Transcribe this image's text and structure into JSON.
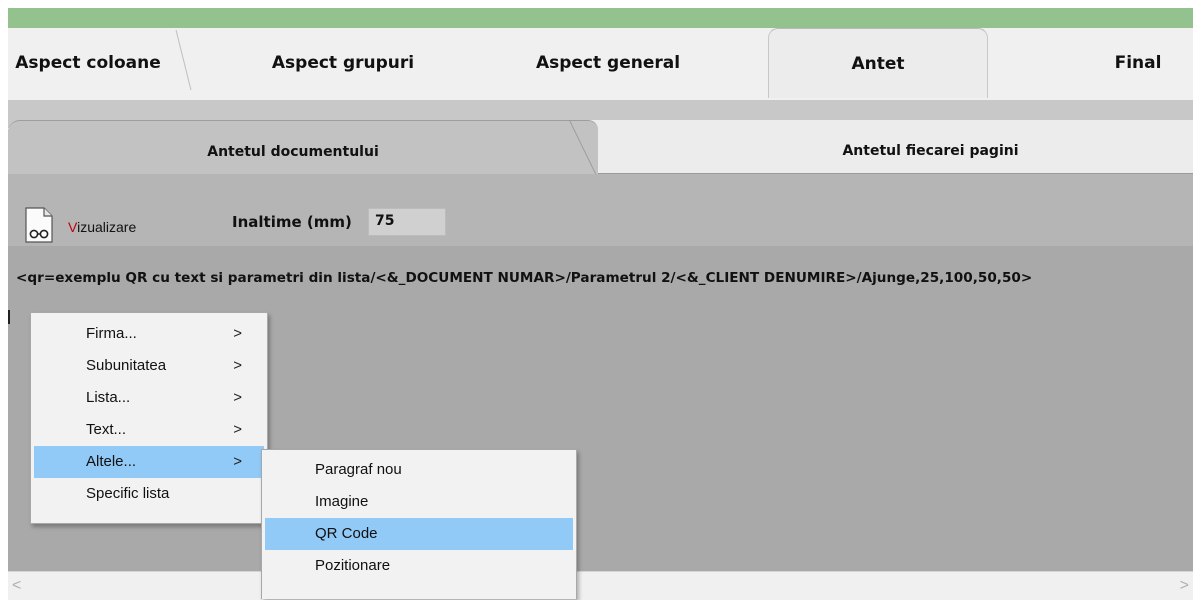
{
  "tabs": [
    "Aspect coloane",
    "Aspect grupuri",
    "Aspect general",
    "Antet",
    "Final"
  ],
  "active_tab": "Antet",
  "subtabs": [
    "Antetul documentului",
    "Antetul fiecarei pagini"
  ],
  "active_subtab": "Antetul documentului",
  "vizualizare": {
    "first_letter": "V",
    "rest": "izualizare"
  },
  "inaltime": {
    "label": "Inaltime (mm)",
    "value": "75"
  },
  "editor_text": "<qr=exemplu QR cu text si parametri din lista/<&_DOCUMENT NUMAR>/Parametrul 2/<&_CLIENT DENUMIRE>/Ajunge,25,100,50,50>",
  "context_menu": {
    "items": [
      {
        "label": "Firma...",
        "submenu": true
      },
      {
        "label": "Subunitatea",
        "submenu": true
      },
      {
        "label": "Lista...",
        "submenu": true
      },
      {
        "label": "Text...",
        "submenu": true
      },
      {
        "label": "Altele...",
        "submenu": true,
        "highlighted": true
      },
      {
        "label": "Specific lista",
        "submenu": false
      }
    ],
    "arrow": ">"
  },
  "submenu": {
    "items": [
      {
        "label": "Paragraf nou"
      },
      {
        "label": "Imagine"
      },
      {
        "label": "QR Code",
        "highlighted": true
      },
      {
        "label": "Pozitionare"
      }
    ]
  },
  "scrollbar": {
    "left_arrow": "<",
    "right_arrow": ">"
  },
  "colors": {
    "top_bar": "#93c28f",
    "menu_highlight": "#91c9f7",
    "panel_bg": "#a9a9a9",
    "accent_red": "#c0000a"
  }
}
